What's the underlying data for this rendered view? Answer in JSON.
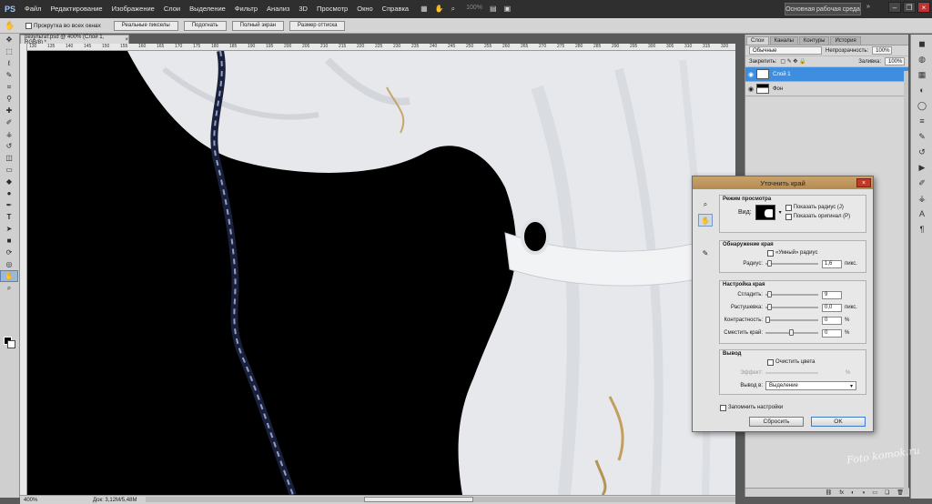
{
  "app": {
    "logo": "PS",
    "brand_color": "#9ec7ff"
  },
  "menubar": {
    "items": [
      "Файл",
      "Редактирование",
      "Изображение",
      "Слои",
      "Выделение",
      "Фильтр",
      "Анализ",
      "3D",
      "Просмотр",
      "Окно",
      "Справка"
    ],
    "zoom": "100%",
    "workspace_button": "Основная рабочая среда",
    "workspace_extra": "»"
  },
  "options": {
    "scroll_all_label": "Прокрутка во всех окнах",
    "buttons": [
      "Реальные пикселы",
      "Подогнать",
      "Полный экран",
      "Размер оттиска"
    ]
  },
  "document": {
    "tab_title": "результат.psd @ 400% (Слой 1, RGB/8) *",
    "tab_close": "×",
    "ruler_h": [
      "130",
      "135",
      "140",
      "145",
      "150",
      "155",
      "160",
      "165",
      "170",
      "175",
      "180",
      "185",
      "190",
      "195",
      "200",
      "205",
      "210",
      "215",
      "220",
      "225",
      "230",
      "235",
      "240",
      "245",
      "250",
      "255",
      "260",
      "265",
      "270",
      "275",
      "280",
      "285",
      "290",
      "295",
      "300",
      "305",
      "310",
      "315",
      "320"
    ],
    "zoom": "400%",
    "doc_size": "Док: 3,12M/5,48M"
  },
  "layers_panel": {
    "tabs": [
      "Слои",
      "Каналы",
      "Контуры",
      "История"
    ],
    "blend_mode": "Обычные",
    "opacity_label": "Непрозрачность:",
    "opacity_value": "100%",
    "lock_label": "Закрепить:",
    "fill_label": "Заливка:",
    "fill_value": "100%",
    "layers": [
      {
        "name": "Слой 1",
        "selected": true
      },
      {
        "name": "Фон",
        "selected": false
      }
    ]
  },
  "dialog": {
    "title": "Уточнить край",
    "view_mode": {
      "title": "Режим просмотра",
      "view_label": "Вид:",
      "show_radius": "Показать радиус (J)",
      "show_original": "Показать оригинал (P)"
    },
    "edge_detection": {
      "title": "Обнаружение края",
      "smart_radius": "«Умный» радиус",
      "radius_label": "Радиус:",
      "radius_value": "1,6",
      "radius_unit": "пикс."
    },
    "adjust_edge": {
      "title": "Настройка края",
      "smooth_label": "Сгладить:",
      "smooth_value": "9",
      "feather_label": "Растушевка:",
      "feather_value": "0,0",
      "feather_unit": "пикс.",
      "contrast_label": "Контрастность:",
      "contrast_value": "0",
      "shift_label": "Сместить край:",
      "shift_value": "0",
      "percent": "%"
    },
    "output": {
      "title": "Вывод",
      "decontaminate": "Очистить цвета",
      "amount_label": "Эффект:",
      "amount_unit": "%",
      "output_to_label": "Вывод в:",
      "output_to_value": "Выделение"
    },
    "remember": "Запомнить настройки",
    "cancel": "Сбросить",
    "ok": "OK"
  },
  "watermark": "Foto komok.ru"
}
